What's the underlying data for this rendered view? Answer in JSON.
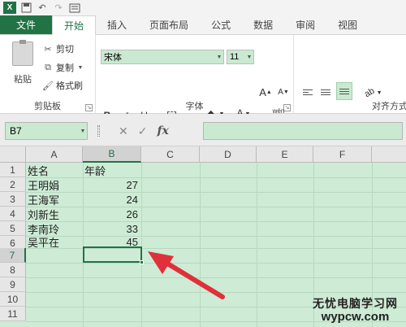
{
  "quick_access": {
    "app_icon": "X",
    "save_icon": "save-icon",
    "undo_icon": "undo-icon",
    "redo_icon": "redo-icon",
    "customize_icon": "customize-icon"
  },
  "tabs": [
    {
      "label": "文件"
    },
    {
      "label": "开始"
    },
    {
      "label": "插入"
    },
    {
      "label": "页面布局"
    },
    {
      "label": "公式"
    },
    {
      "label": "数据"
    },
    {
      "label": "审阅"
    },
    {
      "label": "视图"
    }
  ],
  "clipboard": {
    "paste_label": "粘贴",
    "cut_label": "剪切",
    "copy_label": "复制",
    "format_painter_label": "格式刷",
    "group_label": "剪贴板"
  },
  "font": {
    "name": "宋体",
    "size": "11",
    "grow_label": "A",
    "shrink_label": "A",
    "bold_label": "B",
    "italic_label": "I",
    "underline_label": "U",
    "color_label": "A",
    "phonetic_label": "wén",
    "group_label": "字体",
    "accent_color": "#c00000"
  },
  "alignment": {
    "group_label": "对齐方式"
  },
  "formula_bar": {
    "name_box": "B7",
    "cancel_symbol": "✕",
    "enter_symbol": "✓",
    "fx_symbol": "fx",
    "value": ""
  },
  "grid": {
    "columns": [
      "A",
      "B",
      "C",
      "D",
      "E",
      "F"
    ],
    "rows": [
      "1",
      "2",
      "3",
      "4",
      "5",
      "6",
      "7",
      "8",
      "9",
      "10",
      "11"
    ],
    "data": [
      {
        "name": "姓名",
        "age": "年龄"
      },
      {
        "name": "王明娟",
        "age": "27"
      },
      {
        "name": "王海军",
        "age": "24"
      },
      {
        "name": "刘新生",
        "age": "26"
      },
      {
        "name": "李南玲",
        "age": "33"
      },
      {
        "name": "吴平在",
        "age": "45"
      }
    ],
    "active_cell": "B7"
  },
  "watermark": {
    "title": "无忧电脑学习网",
    "url": "wypcw.com"
  },
  "colors": {
    "excel_green": "#217346",
    "cell_bg": "#cdebd5",
    "arrow": "#e0303a"
  }
}
